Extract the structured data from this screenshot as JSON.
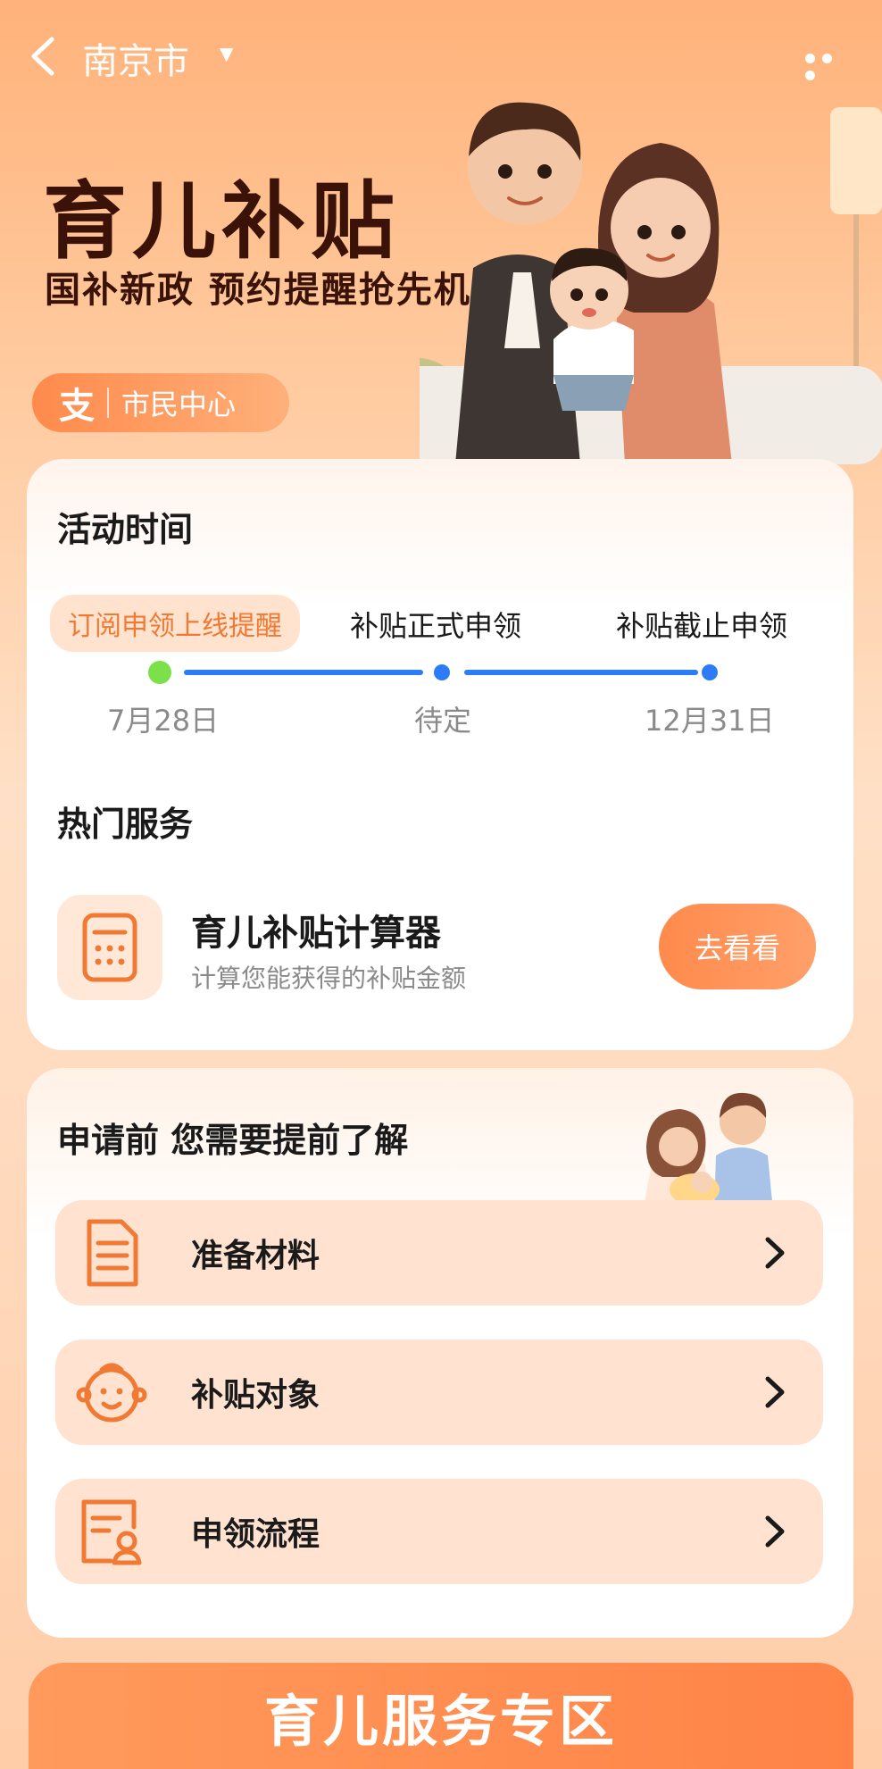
{
  "nav": {
    "city": "南京市"
  },
  "hero": {
    "title": "育儿补贴",
    "subtitle": "国补新政 预约提醒抢先机",
    "badge_logo": "支",
    "badge_text": "市民中心"
  },
  "activity": {
    "title": "活动时间",
    "steps": [
      {
        "label": "订阅申领上线提醒",
        "date": "7月28日",
        "active": true
      },
      {
        "label": "补贴正式申领",
        "date": "待定",
        "active": false
      },
      {
        "label": "补贴截止申领",
        "date": "12月31日",
        "active": false
      }
    ]
  },
  "hot_services": {
    "title": "热门服务",
    "item": {
      "title": "育儿补贴计算器",
      "desc": "计算您能获得的补贴金额",
      "button": "去看看",
      "icon": "calculator-icon"
    }
  },
  "before_apply": {
    "title": "申请前 您需要提前了解",
    "items": [
      {
        "label": "准备材料",
        "icon": "document-icon"
      },
      {
        "label": "补贴对象",
        "icon": "baby-face-icon"
      },
      {
        "label": "申领流程",
        "icon": "process-form-icon"
      }
    ]
  },
  "bottom": {
    "label": "育儿服务专区"
  },
  "colors": {
    "accent": "#ff8a4c",
    "title_dark": "#3b1208",
    "timeline_blue": "#2b7cf6",
    "active_dot": "#7be04a"
  }
}
